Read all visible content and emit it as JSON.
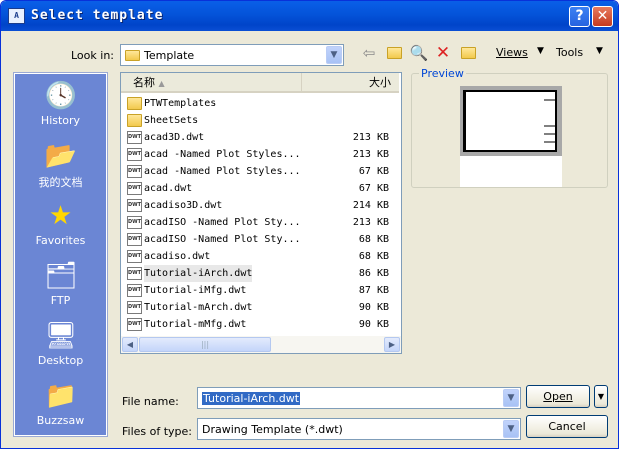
{
  "window": {
    "title": "Select template",
    "app_icon_text": "A",
    "help_label": "?",
    "close_label": "✕"
  },
  "lookin": {
    "label": "Look in:",
    "value": "Template"
  },
  "toolbar": {
    "views_label": "Views",
    "tools_label": "Tools"
  },
  "places": [
    {
      "label": "History",
      "icon": "history-icon"
    },
    {
      "label": "我的文档",
      "icon": "my-documents-icon"
    },
    {
      "label": "Favorites",
      "icon": "favorites-icon"
    },
    {
      "label": "FTP",
      "icon": "ftp-icon"
    },
    {
      "label": "Desktop",
      "icon": "desktop-icon"
    },
    {
      "label": "Buzzsaw",
      "icon": "buzzsaw-icon"
    }
  ],
  "file_list": {
    "columns": {
      "name": "名称",
      "size": "大小"
    },
    "files": [
      {
        "name": "PTWTemplates",
        "size": "",
        "type": "folder"
      },
      {
        "name": "SheetSets",
        "size": "",
        "type": "folder"
      },
      {
        "name": "acad3D.dwt",
        "size": "213 KB",
        "type": "dwt"
      },
      {
        "name": "acad -Named Plot Styles...",
        "size": "213 KB",
        "type": "dwt"
      },
      {
        "name": "acad -Named Plot Styles...",
        "size": "67 KB",
        "type": "dwt"
      },
      {
        "name": "acad.dwt",
        "size": "67 KB",
        "type": "dwt"
      },
      {
        "name": "acadiso3D.dwt",
        "size": "214 KB",
        "type": "dwt"
      },
      {
        "name": "acadISO -Named Plot Sty...",
        "size": "213 KB",
        "type": "dwt"
      },
      {
        "name": "acadISO -Named Plot Sty...",
        "size": "68 KB",
        "type": "dwt"
      },
      {
        "name": "acadiso.dwt",
        "size": "68 KB",
        "type": "dwt"
      },
      {
        "name": "Tutorial-iArch.dwt",
        "size": "86 KB",
        "type": "dwt",
        "selected": true
      },
      {
        "name": "Tutorial-iMfg.dwt",
        "size": "87 KB",
        "type": "dwt"
      },
      {
        "name": "Tutorial-mArch.dwt",
        "size": "90 KB",
        "type": "dwt"
      },
      {
        "name": "Tutorial-mMfg.dwt",
        "size": "90 KB",
        "type": "dwt"
      }
    ],
    "dwt_badge": "DWT"
  },
  "preview": {
    "label": "Preview"
  },
  "filename": {
    "label": "File name:",
    "value": "Tutorial-iArch.dwt"
  },
  "filetype": {
    "label": "Files of type:",
    "value": "Drawing Template (*.dwt)"
  },
  "buttons": {
    "open": "Open",
    "cancel": "Cancel"
  }
}
